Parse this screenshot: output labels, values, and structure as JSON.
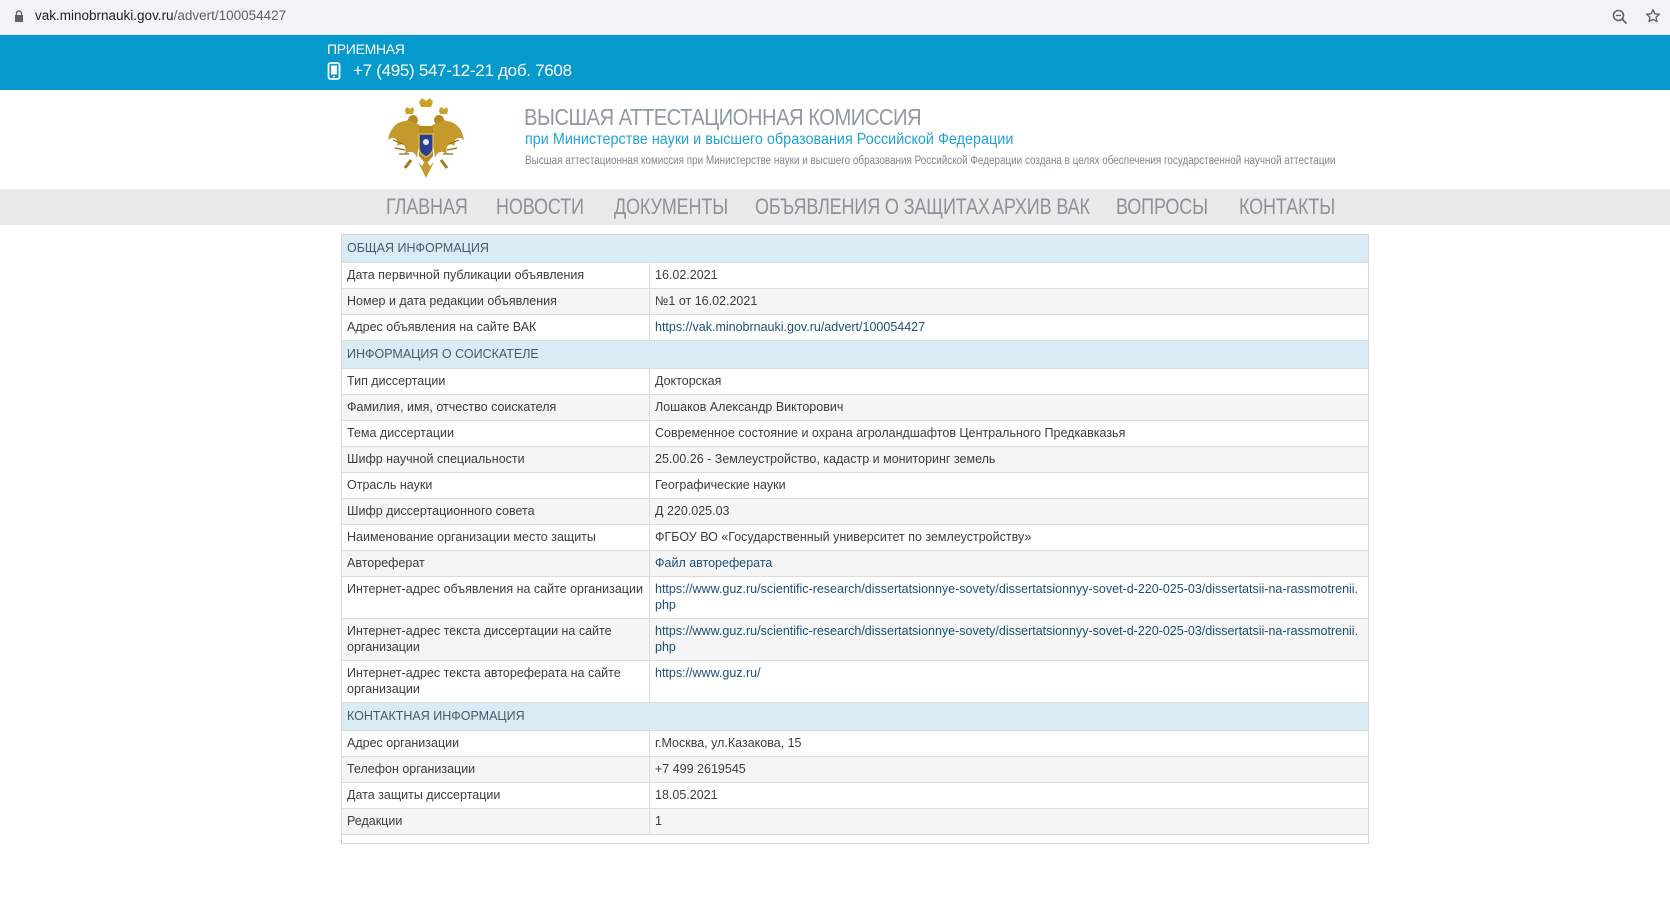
{
  "browser": {
    "url_host": "vak.minobrnauki.gov.ru",
    "url_path": "/advert/100054427"
  },
  "band": {
    "reception": "ПРИЕМНАЯ",
    "phone": "+7 (495) 547-12-21 доб. 7608"
  },
  "header": {
    "title": "ВЫСШАЯ АТТЕСТАЦИОННАЯ КОМИССИЯ",
    "subtitle": "при Министерстве науки и высшего образования Российской Федерации",
    "description": "Высшая аттестационная комиссия при Министерстве науки и высшего образования Российской Федерации создана в целях обеспечения государственной научной аттестации"
  },
  "nav": [
    "ГЛАВНАЯ",
    "НОВОСТИ",
    "ДОКУМЕНТЫ",
    "ОБЪЯВЛЕНИЯ О ЗАЩИТАХ",
    "АРХИВ ВАК",
    "ВОПРОСЫ",
    "КОНТАКТЫ"
  ],
  "sections": [
    {
      "title": "ОБЩАЯ ИНФОРМАЦИЯ",
      "rows": [
        {
          "label": "Дата первичной публикации объявления",
          "value": "16.02.2021"
        },
        {
          "label": "Номер и дата редакции объявления",
          "value": "№1 от 16.02.2021"
        },
        {
          "label": "Адрес объявления на сайте ВАК",
          "value": "https://vak.minobrnauki.gov.ru/advert/100054427",
          "link": true
        }
      ]
    },
    {
      "title": "ИНФОРМАЦИЯ О СОИСКАТЕЛЕ",
      "rows": [
        {
          "label": "Тип диссертации",
          "value": "Докторская"
        },
        {
          "label": "Фамилия, имя, отчество соискателя",
          "value": "Лошаков Александр Викторович"
        },
        {
          "label": "Тема диссертации",
          "value": "Современное состояние и охрана агроландшафтов Центрального Предкавказья"
        },
        {
          "label": "Шифр научной специальности",
          "value": "25.00.26 - Землеустройство, кадастр и мониторинг земель"
        },
        {
          "label": "Отрасль науки",
          "value": "Географические науки"
        },
        {
          "label": "Шифр диссертационного совета",
          "value": "Д 220.025.03"
        },
        {
          "label": "Наименование организации место защиты",
          "value": "ФГБОУ ВО «Государственный университет по землеустройству»"
        },
        {
          "label": "Автореферат",
          "value": "Файл автореферата",
          "link": true
        },
        {
          "label": "Интернет-адрес объявления на сайте организации",
          "value": "https://www.guz.ru/scientific-research/dissertatsionnye-sovety/dissertatsionnyy-sovet-d-220-025-03/dissertatsii-na-rassmotrenii.php",
          "link": true
        },
        {
          "label": "Интернет-адрес текста диссертации на сайте организации",
          "value": "https://www.guz.ru/scientific-research/dissertatsionnye-sovety/dissertatsionnyy-sovet-d-220-025-03/dissertatsii-na-rassmotrenii.php",
          "link": true
        },
        {
          "label": "Интернет-адрес текста автореферата на сайте организации",
          "value": "https://www.guz.ru/",
          "link": true
        }
      ]
    },
    {
      "title": "КОНТАКТНАЯ ИНФОРМАЦИЯ",
      "rows": [
        {
          "label": "Адрес организации",
          "value": "г.Москва, ул.Казакова, 15"
        },
        {
          "label": "Телефон организации",
          "value": "+7 499 2619545"
        },
        {
          "label": "Дата защиты диссертации",
          "value": "18.05.2021"
        },
        {
          "label": "Редакции",
          "value": "1"
        }
      ]
    }
  ],
  "colors": {
    "band": "#0599cc",
    "section_header": "#d9ebf5",
    "nav_bg": "#e9e9e9",
    "link": "#1d4f7a"
  }
}
